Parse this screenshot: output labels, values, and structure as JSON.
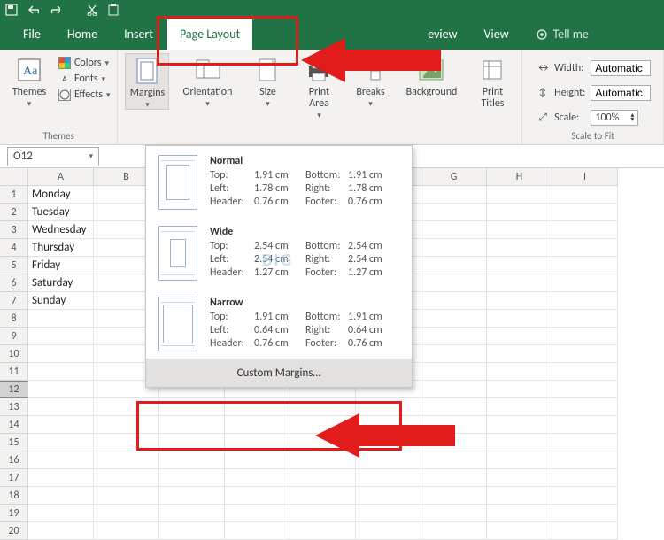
{
  "tabs": {
    "file": "File",
    "home": "Home",
    "insert": "Insert",
    "pagelayout": "Page Layout",
    "review": "eview",
    "view": "View",
    "tellme": "Tell me"
  },
  "ribbon": {
    "themes": {
      "btn": "Themes",
      "colors": "Colors",
      "fonts": "Fonts",
      "effects": "Effects",
      "group": "Themes"
    },
    "pagesetup": {
      "margins": "Margins",
      "orientation": "Orientation",
      "size": "Size",
      "printarea": "Print\nArea",
      "breaks": "Breaks",
      "background": "Background",
      "printtitles": "Print\nTitles"
    },
    "scale": {
      "width": "Width:",
      "height": "Height:",
      "scale": "Scale:",
      "auto": "Automatic",
      "pct": "100%",
      "group": "Scale to Fit"
    }
  },
  "namebox": "O12",
  "cols": [
    "A",
    "B",
    "G",
    "H",
    "I"
  ],
  "rows": [
    "1",
    "2",
    "3",
    "4",
    "5",
    "6",
    "7",
    "8",
    "9",
    "10",
    "11",
    "12",
    "13",
    "14",
    "15",
    "16",
    "17",
    "18",
    "19",
    "20"
  ],
  "days": [
    "Monday",
    "Tuesday",
    "Wednesday",
    "Thursday",
    "Friday",
    "Saturday",
    "Sunday"
  ],
  "dropdown": {
    "normal": {
      "title": "Normal",
      "top": "Top:",
      "top_v": "1.91 cm",
      "bottom": "Bottom:",
      "bottom_v": "1.91 cm",
      "left": "Left:",
      "left_v": "1.78 cm",
      "right": "Right:",
      "right_v": "1.78 cm",
      "header": "Header:",
      "header_v": "0.76 cm",
      "footer": "Footer:",
      "footer_v": "0.76 cm"
    },
    "wide": {
      "title": "Wide",
      "top": "Top:",
      "top_v": "2.54 cm",
      "bottom": "Bottom:",
      "bottom_v": "2.54 cm",
      "left": "Left:",
      "left_v": "2.54 cm",
      "right": "Right:",
      "right_v": "2.54 cm",
      "header": "Header:",
      "header_v": "1.27 cm",
      "footer": "Footer:",
      "footer_v": "1.27 cm"
    },
    "narrow": {
      "title": "Narrow",
      "top": "Top:",
      "top_v": "1.91 cm",
      "bottom": "Bottom:",
      "bottom_v": "1.91 cm",
      "left": "Left:",
      "left_v": "0.64 cm",
      "right": "Right:",
      "right_v": "0.64 cm",
      "header": "Header:",
      "header_v": "0.76 cm",
      "footer": "Footer:",
      "footer_v": "0.76 cm"
    },
    "custom": "Custom Margins…"
  },
  "watermark": "BIG"
}
